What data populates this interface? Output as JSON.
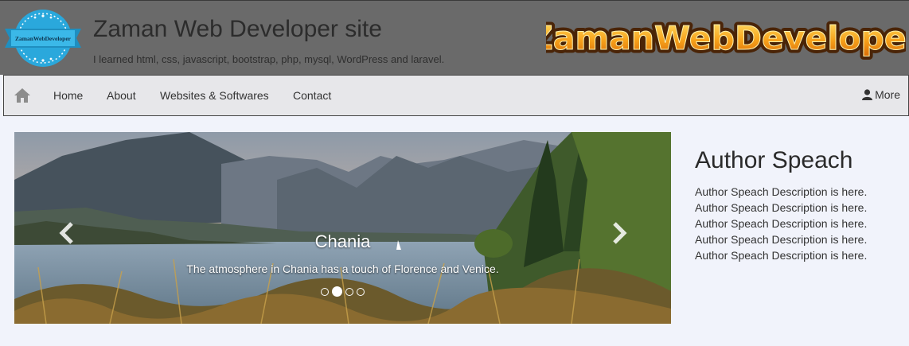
{
  "header": {
    "logo_text": "ZamanWebDeveloper",
    "title": "Zaman Web Developer site",
    "tagline": "I learned html, css, javascript, bootstrap, php, mysql, WordPress and laravel.",
    "wordmark": "ZamanWebDeveloper"
  },
  "navbar": {
    "home_icon": "home-icon",
    "items": [
      {
        "label": "Home"
      },
      {
        "label": "About"
      },
      {
        "label": "Websites & Softwares"
      },
      {
        "label": "Contact"
      }
    ],
    "more_label": "More",
    "more_icon": "user-icon"
  },
  "carousel": {
    "caption_title": "Chania",
    "caption_text": "The atmosphere in Chania has a touch of Florence and Venice.",
    "slide_count": 4,
    "active_index": 1
  },
  "author": {
    "title": "Author Speach",
    "lines": [
      "Author Speach Description is here.",
      "Author Speach Description is here.",
      "Author Speach Description is here.",
      "Author Speach Description is here.",
      "Author Speach Description is here."
    ]
  },
  "colors": {
    "header_bg": "#6a6a6a",
    "nav_bg": "#e7e7ea",
    "page_bg": "#f1f3fb",
    "logo_blue": "#29a7d9",
    "wordmark_orange": "#f7a21b"
  }
}
